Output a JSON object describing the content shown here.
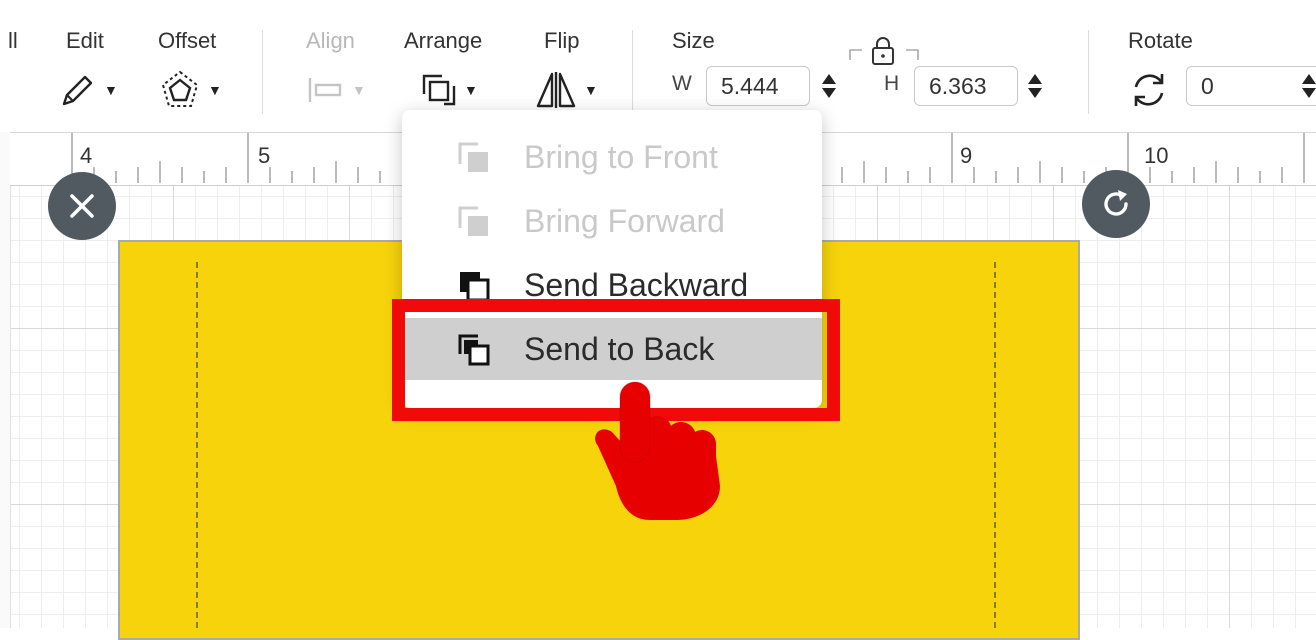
{
  "toolbar": {
    "partial_left": "ll",
    "edit": "Edit",
    "offset": "Offset",
    "align": "Align",
    "arrange": "Arrange",
    "flip": "Flip",
    "size": "Size",
    "width_label": "W",
    "width_value": "5.444",
    "height_label": "H",
    "height_value": "6.363",
    "rotate": "Rotate",
    "rotate_value": "0",
    "icons": [
      "pencil-icon",
      "offset-icon",
      "align-icon",
      "arrange-icon",
      "flip-icon",
      "lock-icon",
      "rotate-icon",
      "stepper-icon"
    ]
  },
  "ruler": {
    "marks": [
      "4",
      "5",
      "9",
      "10"
    ]
  },
  "canvas": {
    "object_color": "#f7d30c",
    "delete_icon": "close-icon",
    "rotate_handle_icon": "rotate-handle-icon"
  },
  "arrange_menu": {
    "items": [
      {
        "label": "Bring to Front",
        "enabled": false
      },
      {
        "label": "Bring Forward",
        "enabled": false
      },
      {
        "label": "Send Backward",
        "enabled": true
      },
      {
        "label": "Send to Back",
        "enabled": true,
        "selected": true
      }
    ]
  },
  "annotation": {
    "highlight_color": "#f00a0a",
    "pointer_icon": "pointing-hand-icon"
  }
}
